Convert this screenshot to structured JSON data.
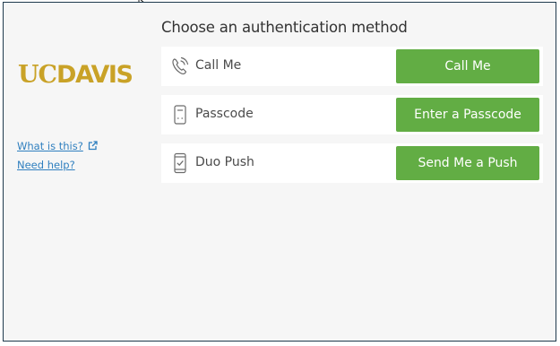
{
  "brand": {
    "logo_uc": "UC",
    "logo_davis": "DAVIS",
    "logo_color": "#c9a227"
  },
  "sidebar": {
    "what_is_this": "What is this?",
    "need_help": "Need help?",
    "link_color": "#2f7fbf"
  },
  "main": {
    "heading": "Choose an authentication method",
    "methods": [
      {
        "label": "Call Me",
        "icon": "phone-icon",
        "button": "Call Me"
      },
      {
        "label": "Passcode",
        "icon": "token-icon",
        "button": "Enter a Passcode"
      },
      {
        "label": "Duo Push",
        "icon": "mobile-push-icon",
        "button": "Send Me a Push"
      }
    ],
    "button_color": "#62ad44"
  }
}
